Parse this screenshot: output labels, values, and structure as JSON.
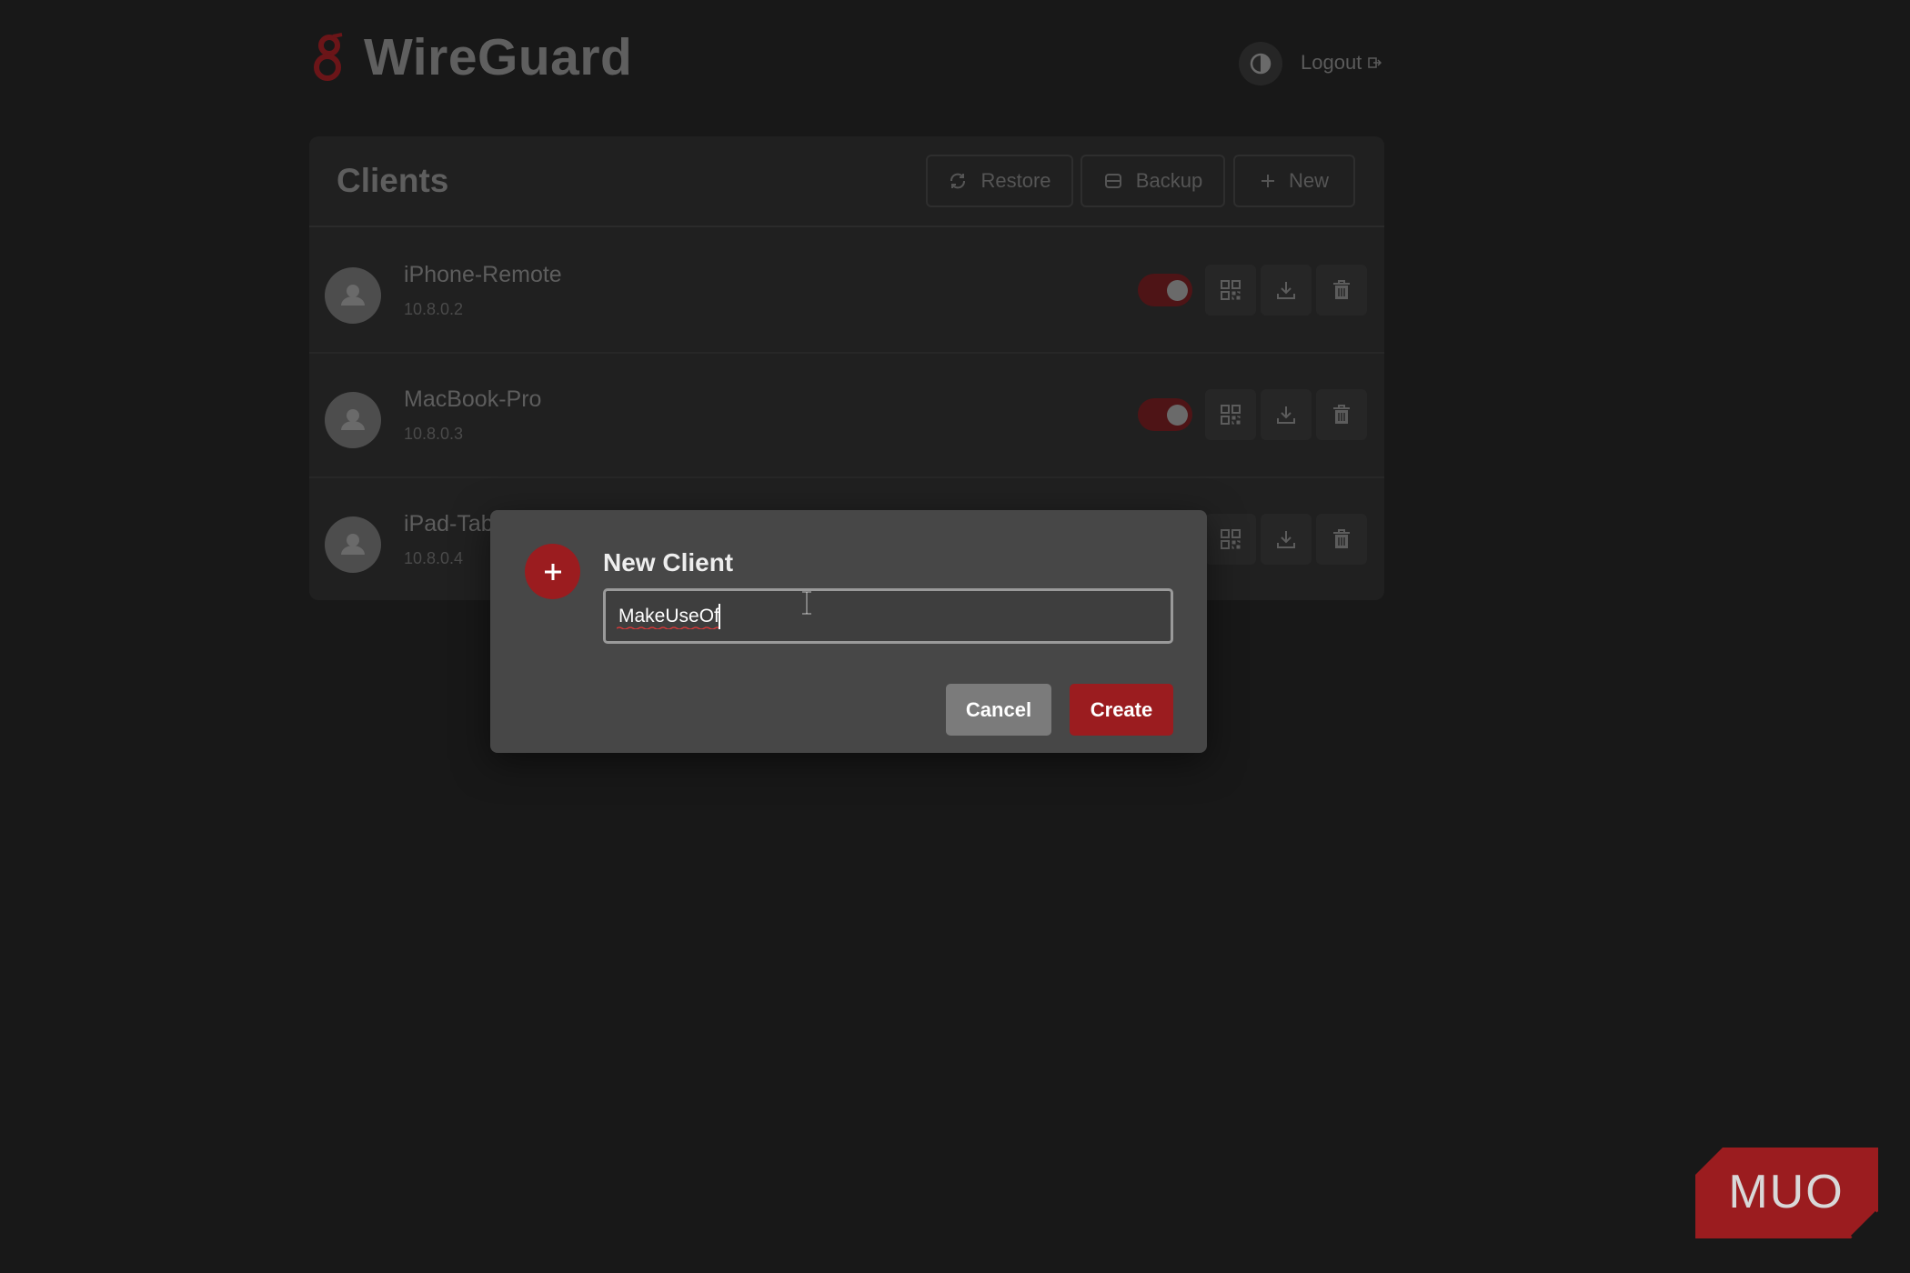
{
  "header": {
    "title": "WireGuard",
    "logout_label": "Logout",
    "theme_toggle_icon": "contrast-icon"
  },
  "clients_panel": {
    "title": "Clients",
    "buttons": {
      "restore": "Restore",
      "backup": "Backup",
      "new": "New"
    },
    "clients": [
      {
        "name": "iPhone-Remote",
        "ip": "10.8.0.2",
        "enabled": true
      },
      {
        "name": "MacBook-Pro",
        "ip": "10.8.0.3",
        "enabled": true
      },
      {
        "name": "iPad-Tab",
        "ip": "10.8.0.4",
        "enabled": true
      }
    ]
  },
  "modal": {
    "title": "New Client",
    "input_value": "MakeUseOf",
    "cancel_label": "Cancel",
    "create_label": "Create"
  },
  "watermark": {
    "text": "MUO"
  },
  "colors": {
    "background": "#181818",
    "accent": "#9b1c1f",
    "panel": "#202020",
    "modal": "#474747"
  }
}
